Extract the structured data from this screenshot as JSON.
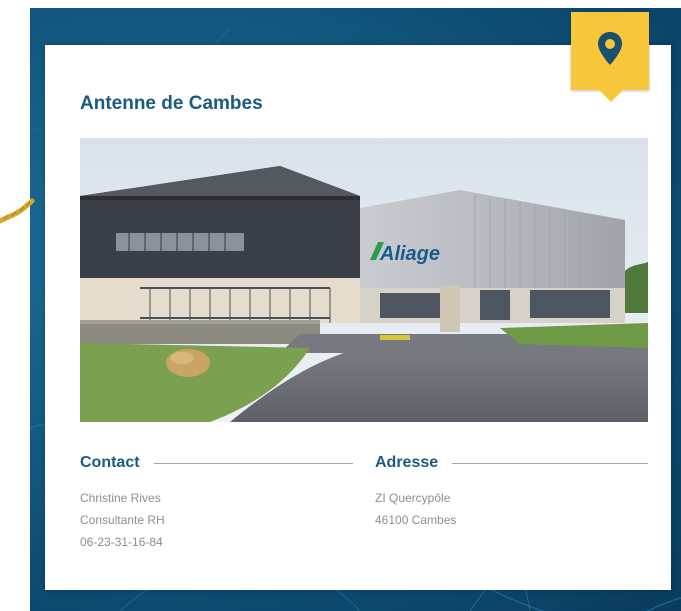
{
  "card": {
    "title": "Antenne de Cambes"
  },
  "photo": {
    "sign_text": "Aliage"
  },
  "contact": {
    "heading": "Contact",
    "name": "Christine Rives",
    "role": "Consultante RH",
    "phone": "06-23-31-16-84"
  },
  "address": {
    "heading": "Adresse",
    "line1": "ZI Quercypôle",
    "line2": "46100 Cambes"
  },
  "icons": {
    "badge": "map-pin-icon"
  },
  "colors": {
    "heading": "#1b5b80",
    "badge": "#f7c63b",
    "background": "#145d86",
    "text_muted": "#8a8f94"
  }
}
